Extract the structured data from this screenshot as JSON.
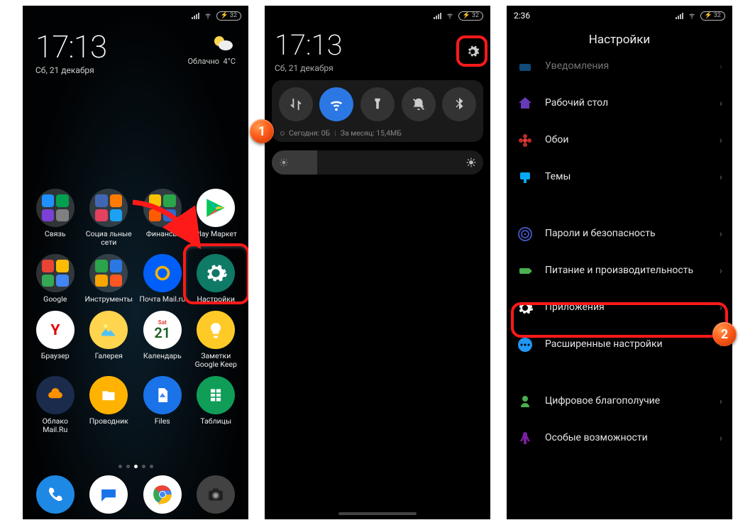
{
  "status": {
    "battery": "32"
  },
  "step_badges": {
    "one": "1",
    "two": "2"
  },
  "phone1": {
    "clock": "17:13",
    "date": "Сб, 21 декабря",
    "weather_label": "Облачно",
    "weather_temp": "4°C",
    "apps": [
      {
        "label": "Связь",
        "type": "folder",
        "colors": [
          "#1e90ff",
          "#00a050",
          "#7b40d6",
          "#808080"
        ]
      },
      {
        "label": "Социа льные сети",
        "type": "folder",
        "colors": [
          "#4267B2",
          "#ff7a00",
          "#e4405f",
          "#1da1f2"
        ]
      },
      {
        "label": "Финансы",
        "type": "folder",
        "colors": [
          "#f8c300",
          "#2aa54b",
          "#ff5c00",
          "#3366cc"
        ]
      },
      {
        "label": "Play Маркет",
        "type": "icon",
        "bg": "#ffffff"
      },
      {
        "label": "Google",
        "type": "folder",
        "colors": [
          "#ea4335",
          "#fbbc05",
          "#34a853",
          "#4285f4"
        ]
      },
      {
        "label": "Инструменты",
        "type": "folder",
        "colors": [
          "#2aa54b",
          "#2b78e4",
          "#f8a500",
          "#ff5722"
        ]
      },
      {
        "label": "Почта Mail.ru",
        "type": "icon",
        "bg": "#005ff9"
      },
      {
        "label": "Настройки",
        "type": "icon",
        "bg": "#0f7a66"
      },
      {
        "label": "Браузер",
        "type": "icon",
        "bg": "#ffffff"
      },
      {
        "label": "Галерея",
        "type": "icon",
        "bg": "#ffd54f"
      },
      {
        "label": "Календарь",
        "type": "cal",
        "bg": "#ffffff",
        "day": "21",
        "dow": "Sat"
      },
      {
        "label": "Заметки Google Keep",
        "type": "icon",
        "bg": "#ffca28"
      },
      {
        "label": "Облако Mail.Ru",
        "type": "icon",
        "bg": "#1a2b4c"
      },
      {
        "label": "Проводник",
        "type": "icon",
        "bg": "#ffb300"
      },
      {
        "label": "Files",
        "type": "icon",
        "bg": "#1a73e8"
      },
      {
        "label": "Таблицы",
        "type": "icon",
        "bg": "#0f9d58"
      }
    ],
    "dock": [
      {
        "name": "phone",
        "bg": "#1e88e5"
      },
      {
        "name": "messages",
        "bg": "#ffffff"
      },
      {
        "name": "chrome",
        "bg": "#ffffff"
      },
      {
        "name": "camera",
        "bg": "#424242"
      }
    ]
  },
  "phone2": {
    "clock": "17:13",
    "date": "Сб, 21 декабря",
    "tiles": [
      {
        "name": "data-icon",
        "active": false
      },
      {
        "name": "wifi-icon",
        "active": true
      },
      {
        "name": "flashlight-icon",
        "active": false
      },
      {
        "name": "dnd-icon",
        "active": false
      },
      {
        "name": "bluetooth-icon",
        "active": false
      }
    ],
    "data_usage_today": "Сегодня: 0Б",
    "data_usage_month": "За месяц: 15,4МБ"
  },
  "phone3": {
    "time": "2:36",
    "title": "Настройки",
    "items": [
      {
        "icon": "bell",
        "color": "#2196f3",
        "label": "Уведомления"
      },
      {
        "icon": "home",
        "color": "#673ab7",
        "label": "Рабочий стол"
      },
      {
        "icon": "flower",
        "color": "#e53935",
        "label": "Обои"
      },
      {
        "icon": "brush",
        "color": "#03a9f4",
        "label": "Темы"
      },
      {
        "sep": true
      },
      {
        "icon": "fingerprint",
        "color": "#3f51b5",
        "label": "Пароли и безопасность"
      },
      {
        "icon": "battery",
        "color": "#4caf50",
        "label": "Питание и производительность"
      },
      {
        "icon": "gear",
        "color": "#2196f3",
        "label": "Приложения",
        "highlight": true
      },
      {
        "icon": "dots",
        "color": "#2196f3",
        "label": "Расширенные настройки"
      },
      {
        "sep": true
      },
      {
        "icon": "wellbeing",
        "color": "#4caf50",
        "label": "Цифровое благополучие"
      },
      {
        "icon": "accessibility",
        "color": "#7b1fa2",
        "label": "Особые возможности"
      }
    ]
  }
}
